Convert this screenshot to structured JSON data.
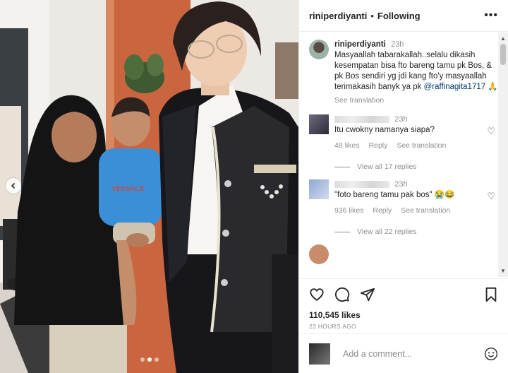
{
  "post": {
    "username": "riniperdiyanti",
    "separator": "•",
    "follow_status": "Following",
    "more_icon": "more-horizontal-icon"
  },
  "caption": {
    "username": "riniperdiyanti",
    "time": "23h",
    "text": "Masyaallah tabarakallah..selalu dikasih kesempatan bisa fto bareng tamu pk Bos, & pk Bos sendiri yg jdi kang fto'y masyaallah terimakasih banyk ya pk",
    "mention": "@raffinagita1717",
    "emoji": "🙏",
    "see_translation": "See translation"
  },
  "comments": [
    {
      "time": "23h",
      "text": "Itu cwokny namanya siapa?",
      "likes": "48 likes",
      "reply": "Reply",
      "see_translation": "See translation",
      "view_replies": "View all 17 replies"
    },
    {
      "time": "23h",
      "text": "\"foto bareng tamu pak bos\" 😭😂",
      "likes": "936 likes",
      "reply": "Reply",
      "see_translation": "See translation",
      "view_replies": "View all 22 replies"
    }
  ],
  "footer": {
    "likes": "110,545 likes",
    "time_ago": "23 HOURS AGO",
    "add_comment_placeholder": "Add a comment..."
  },
  "colors": {
    "text": "#262626",
    "muted": "#8e8e8e",
    "link": "#00376b",
    "border": "#efefef"
  }
}
